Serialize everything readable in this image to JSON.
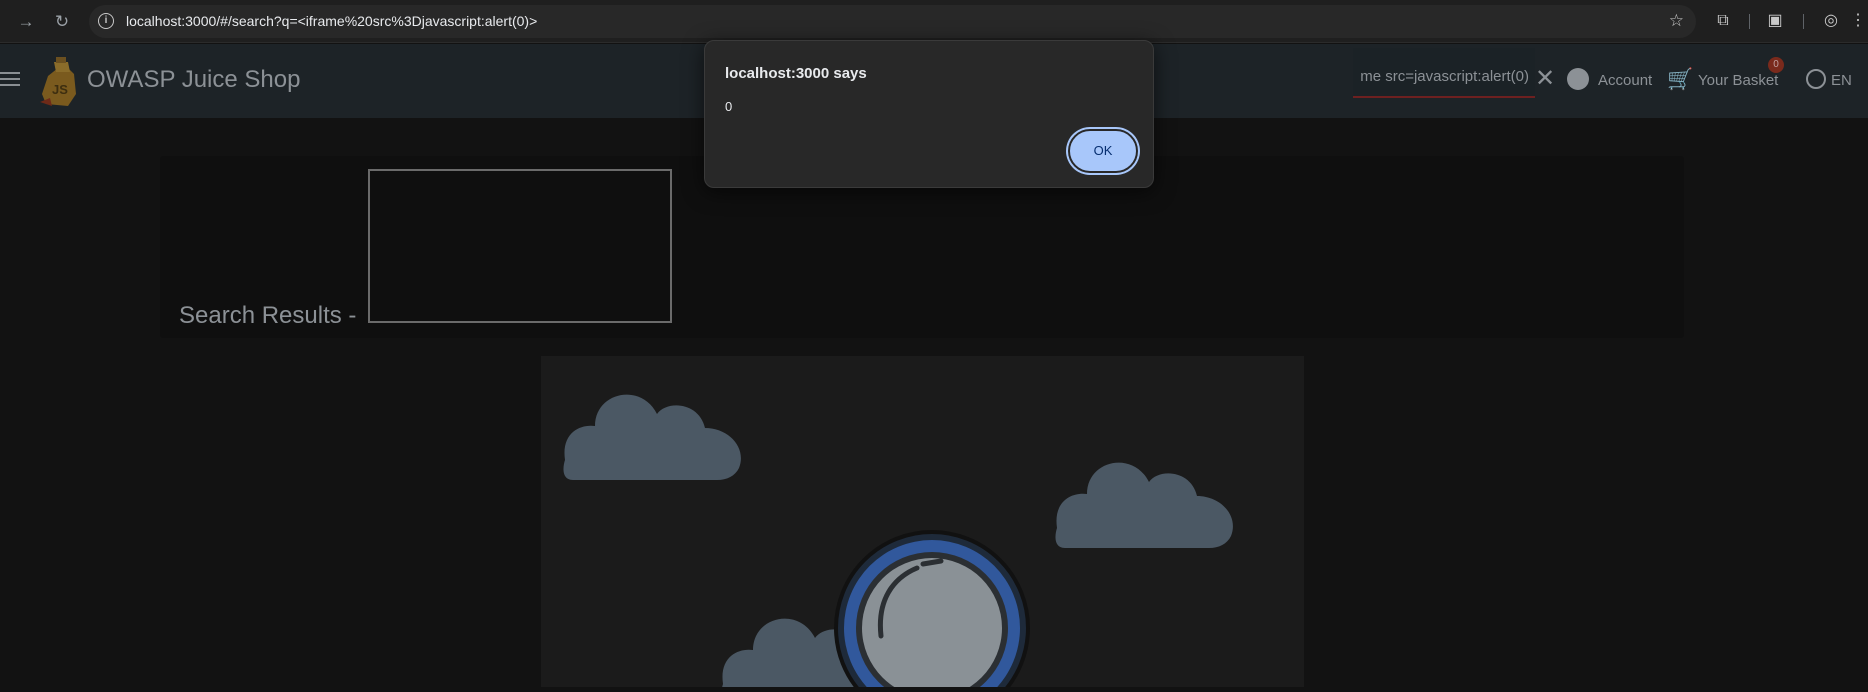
{
  "browser": {
    "url": "localhost:3000/#/search?q=<iframe%20src%3Djavascript:alert(0)>",
    "back_icon": "arrow-right-icon",
    "reload_icon": "reload-icon"
  },
  "app": {
    "brand": "OWASP Juice Shop",
    "search_value": "me src=javascript:alert(0)",
    "account_label": "Account",
    "basket_label": "Your Basket",
    "basket_count": "0",
    "language": "EN"
  },
  "content": {
    "results_title": "Search Results -"
  },
  "dialog": {
    "title": "localhost:3000 says",
    "message": "0",
    "ok_label": "OK"
  },
  "colors": {
    "toolbar": "#263238",
    "background": "#121212",
    "ok_button": "#a8c7fa"
  }
}
